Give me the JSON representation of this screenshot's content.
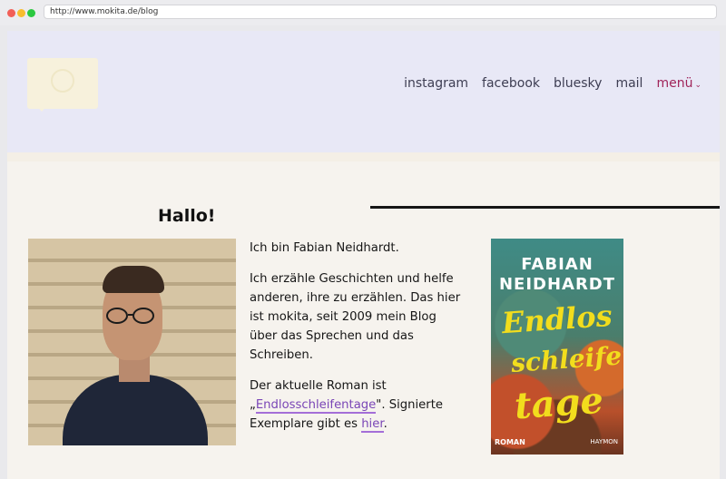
{
  "browser": {
    "url": "http://www.mokita.de/blog"
  },
  "nav": {
    "items": [
      "instagram",
      "facebook",
      "bluesky",
      "mail"
    ],
    "menu_label": "menü",
    "menu_chevron": "⌄"
  },
  "intro": {
    "heading": "Hallo!",
    "p1": "Ich bin Fabian Neidhardt.",
    "p2": "Ich erzähle Geschichten und helfe anderen, ihre zu erzählen. Das hier ist mokita, seit 2009 mein Blog über das Sprechen und das Schreiben.",
    "p3_prefix": "Der aktuelle Roman ist „",
    "p3_link": "Endlosschleifentage",
    "p3_mid": "\". Signierte Exemplare gibt es ",
    "p3_link2": "hier",
    "p3_suffix": "."
  },
  "book": {
    "author_line1": "FABIAN",
    "author_line2": "NEIDHARDT",
    "title1": "Endlos",
    "title2": "schleifen",
    "title3": "tage",
    "genre": "ROMAN",
    "publisher": "HAYMON"
  },
  "colors": {
    "header_bg": "#e8e8f6",
    "page_bg": "#f6f3ee",
    "menu_accent": "#a0245a",
    "link": "#7a46b6"
  },
  "icons": {
    "logo": "speech-bubble-smiley-logo"
  }
}
